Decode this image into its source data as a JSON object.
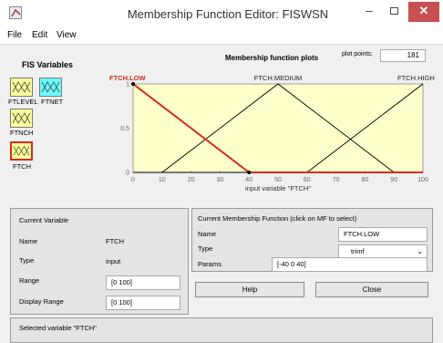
{
  "window": {
    "title": "Membership Function Editor: FISWSN",
    "minimize": "–",
    "close": "✕"
  },
  "menu": [
    "File",
    "Edit",
    "View"
  ],
  "fis_variables": {
    "title": "FIS Variables",
    "inputs": [
      "FTLEVEL",
      "FTNCH",
      "FTCH"
    ],
    "outputs": [
      "FTNET"
    ],
    "selected": "FTCH"
  },
  "plot": {
    "title": "Membership function plots",
    "points_label": "plot points:",
    "points_value": "181"
  },
  "chart_data": {
    "type": "line",
    "xlabel": "input variable \"FTCH\"",
    "xlim": [
      0,
      100
    ],
    "ylim": [
      0,
      1
    ],
    "x_ticks": [
      0,
      10,
      20,
      30,
      40,
      50,
      60,
      70,
      80,
      90,
      100
    ],
    "y_ticks": [
      0,
      0.5,
      1
    ],
    "series": [
      {
        "name": "FTCH.LOW",
        "type": "trimf",
        "params": [
          -40,
          0,
          40
        ],
        "selected": true,
        "color": "#d42b1e"
      },
      {
        "name": "FTCH.MEDIUM",
        "type": "trimf",
        "params": [
          10,
          50,
          90
        ],
        "selected": false,
        "color": "#000000"
      },
      {
        "name": "FTCH.HIGH",
        "type": "trimf",
        "params": [
          60,
          100,
          140
        ],
        "selected": false,
        "color": "#000000"
      }
    ]
  },
  "current_variable": {
    "title": "Current Variable",
    "name_label": "Name",
    "name_value": "FTCH",
    "type_label": "Type",
    "type_value": "input",
    "range_label": "Range",
    "range_value": "[0 100]",
    "display_range_label": "Display Range",
    "display_range_value": "[0 100]"
  },
  "current_mf": {
    "title": "Current Membership Function (click on MF to select)",
    "name_label": "Name",
    "name_value": "FTCH.LOW",
    "type_label": "Type",
    "type_value": "trimf",
    "params_label": "Params",
    "params_value": "[-40 0 40]"
  },
  "buttons": {
    "help": "Help",
    "close": "Close"
  },
  "status": "Selected variable \"FTCH\"",
  "colors": {
    "plot_bg": "#ffffcc",
    "selected_mf": "#d42b1e",
    "input_var": "#ffff99",
    "output_var": "#66ffff",
    "close_btn": "#c75050"
  }
}
